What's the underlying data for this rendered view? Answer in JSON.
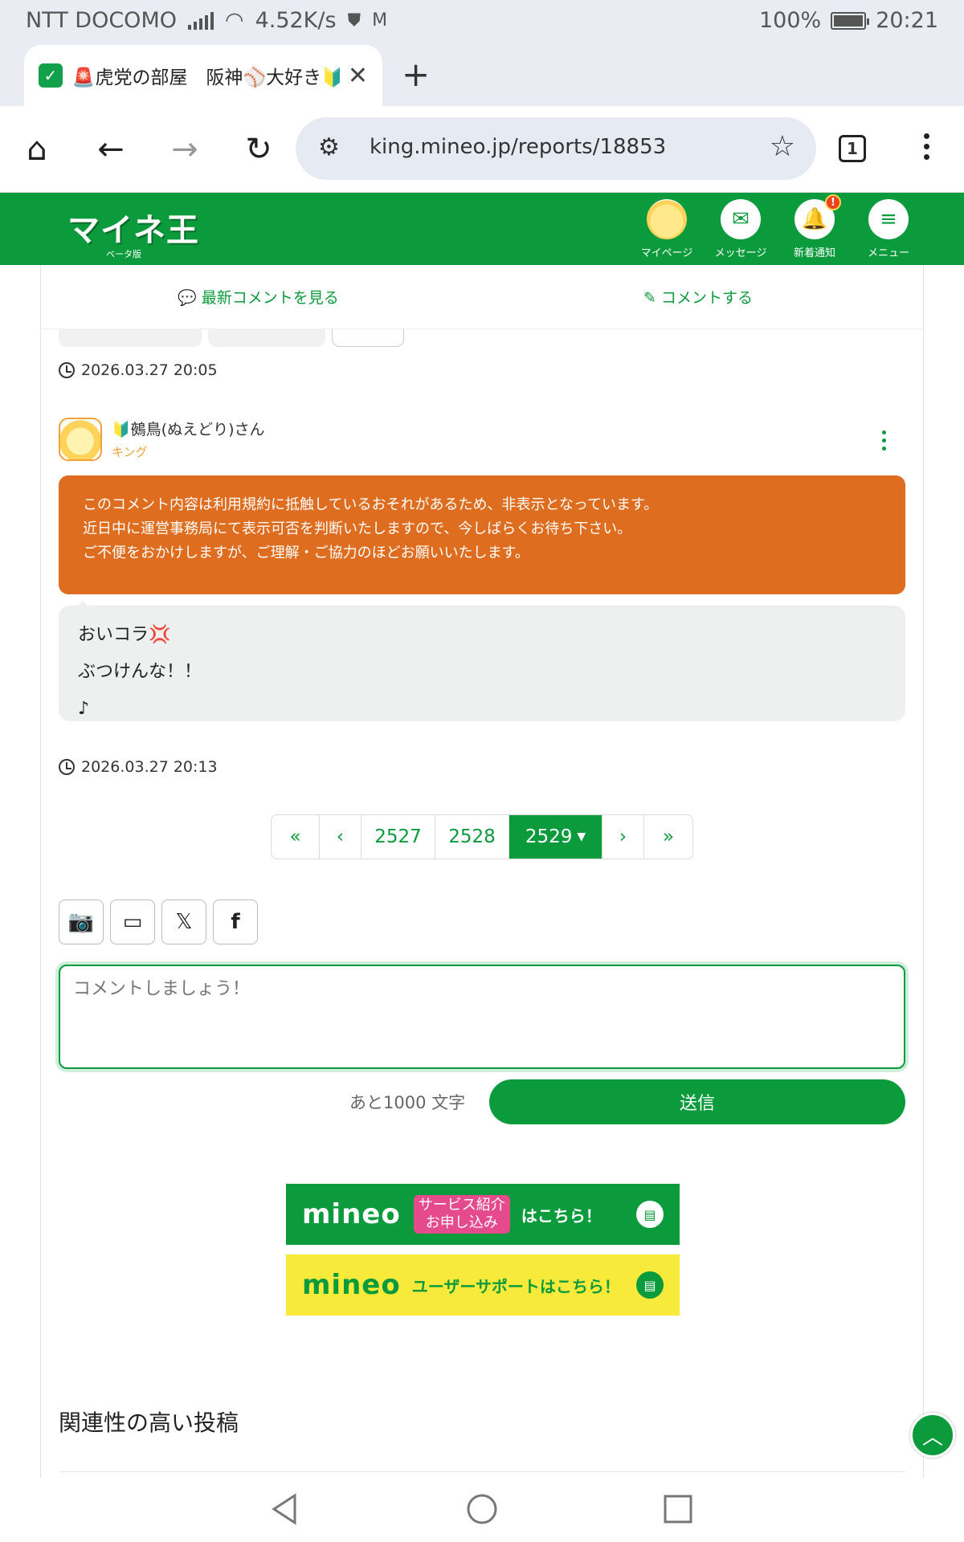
{
  "status_bar": {
    "carrier": "NTT DOCOMO",
    "speed": "4.52K/s",
    "battery": "100%",
    "battery_level": 1.0,
    "time": "20:21"
  },
  "browser": {
    "tab_title": "🚨虎党の部屋　阪神⚾大好き🔰",
    "url": "king.mineo.jp/reports/18853",
    "tab_count": "1"
  },
  "site": {
    "logo_text": "マイネ王",
    "logo_sub": "ベータ版",
    "nav": [
      {
        "label": "マイページ"
      },
      {
        "label": "メッセージ"
      },
      {
        "label": "新着通知",
        "badge": "!"
      },
      {
        "label": "メニュー"
      }
    ],
    "accent": "#0b9b3c"
  },
  "actions": {
    "latest_comments": "最新コメントを見る",
    "comment": "コメントする"
  },
  "prev_timestamp": "2026.03.27 20:05",
  "post": {
    "user_name": "鵺鳥(ぬえどり)さん",
    "rank": "キング",
    "warning": [
      "このコメント内容は利用規約に抵触しているおそれがあるため、非表示となっています。",
      "近日中に運営事務局にて表示可否を判断いたしますので、今しばらくお待ち下さい。",
      "ご不便をおかけしますが、ご理解・ご協力のほどお願いいたします。"
    ],
    "lines": [
      "おいコラ💢",
      "ぶつけんな！！",
      "♪"
    ],
    "timestamp": "2026.03.27 20:13"
  },
  "pagination": {
    "pages": [
      "2527",
      "2528"
    ],
    "current": "2529"
  },
  "comment_box": {
    "placeholder": "コメントしましょう！",
    "remaining": "あと1000 文字",
    "send_label": "送信"
  },
  "banners": {
    "b1": {
      "brand": "mineo",
      "pink": "サービス紹介お申し込み",
      "text": "はこちら！"
    },
    "b2": {
      "brand": "mineo",
      "text": "ユーザーサポートはこちら！"
    }
  },
  "related_heading": "関連性の高い投稿"
}
